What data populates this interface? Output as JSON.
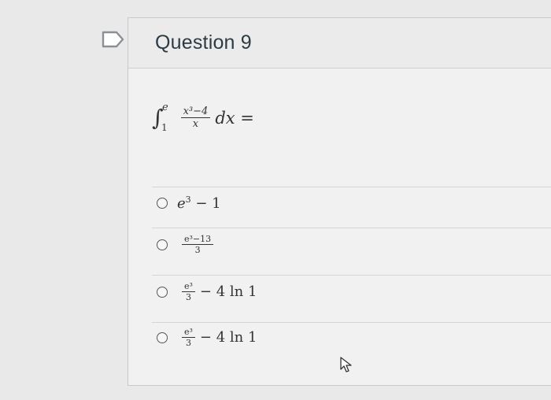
{
  "question": {
    "title": "Question 9",
    "prompt": {
      "integral_upper": "e",
      "integral_lower": "1",
      "numerator": "x³−4",
      "denominator": "x",
      "trailing": "dx ="
    }
  },
  "options": [
    {
      "main": "e",
      "sup": "3",
      "rest": " − 1"
    },
    {
      "num": "e³−13",
      "den": "3"
    },
    {
      "num": "e³",
      "den": "3",
      "rest": "− 4 ln 1"
    },
    {
      "num": "e³",
      "den": "3",
      "rest": "− 4 ln 1"
    }
  ],
  "icons": {
    "bookmark": "bookmark-icon",
    "cursor": "mouse-cursor-icon"
  }
}
